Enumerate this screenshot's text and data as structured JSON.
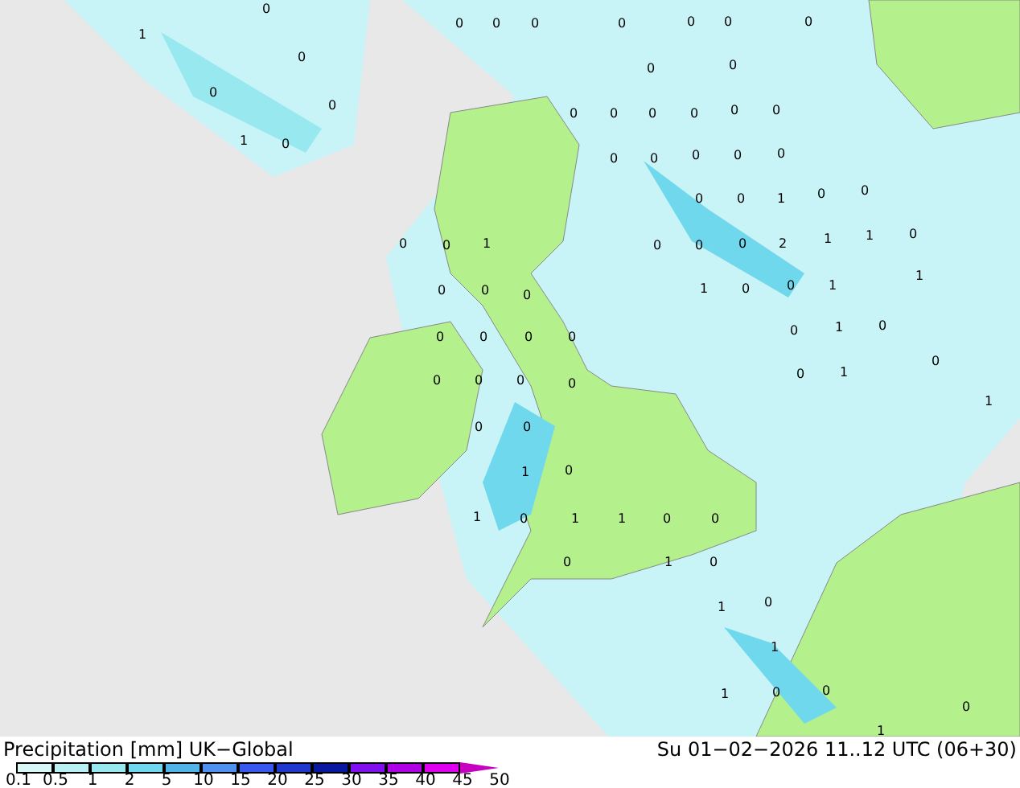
{
  "map": {
    "values": [
      "1",
      "0",
      "0",
      "0",
      "0",
      "1",
      "0",
      "0",
      "0",
      "0",
      "0",
      "0",
      "0",
      "0",
      "0",
      "0",
      "0",
      "0",
      "0",
      "0",
      "0",
      "0",
      "0",
      "0",
      "0",
      "0",
      "0",
      "0",
      "0",
      "1",
      "0",
      "0",
      "0",
      "0",
      "1",
      "0",
      "0",
      "0",
      "2",
      "1",
      "1",
      "0",
      "0",
      "0",
      "0",
      "1",
      "0",
      "0",
      "1",
      "1",
      "0",
      "0",
      "0",
      "0",
      "0",
      "1",
      "0",
      "0",
      "0",
      "0",
      "0",
      "0",
      "1",
      "0",
      "0",
      "0",
      "1",
      "0",
      "1",
      "1",
      "0",
      "1",
      "1",
      "0",
      "0",
      "0",
      "1",
      "0",
      "1",
      "0",
      "1",
      "1",
      "0",
      "0",
      "1",
      "0"
    ]
  },
  "footer": {
    "title": "Precipitation [mm] UK−Global",
    "time": "Su 01−02−2026 11..12 UTC (06+30)"
  },
  "legend": {
    "bins": [
      {
        "color": "#d8f8f8"
      },
      {
        "color": "#b8f0f4"
      },
      {
        "color": "#98e8f0"
      },
      {
        "color": "#70d8ec"
      },
      {
        "color": "#50b4e8"
      },
      {
        "color": "#5090f0"
      },
      {
        "color": "#3858f0"
      },
      {
        "color": "#2038d0"
      },
      {
        "color": "#0818a0"
      },
      {
        "color": "#8010f0"
      },
      {
        "color": "#b000e8"
      },
      {
        "color": "#e000f0"
      },
      {
        "color": "#c800c0"
      }
    ],
    "ticks": [
      "0.1",
      "0.5",
      "1",
      "2",
      "5",
      "10",
      "15",
      "20",
      "25",
      "30",
      "35",
      "40",
      "45",
      "50"
    ]
  }
}
